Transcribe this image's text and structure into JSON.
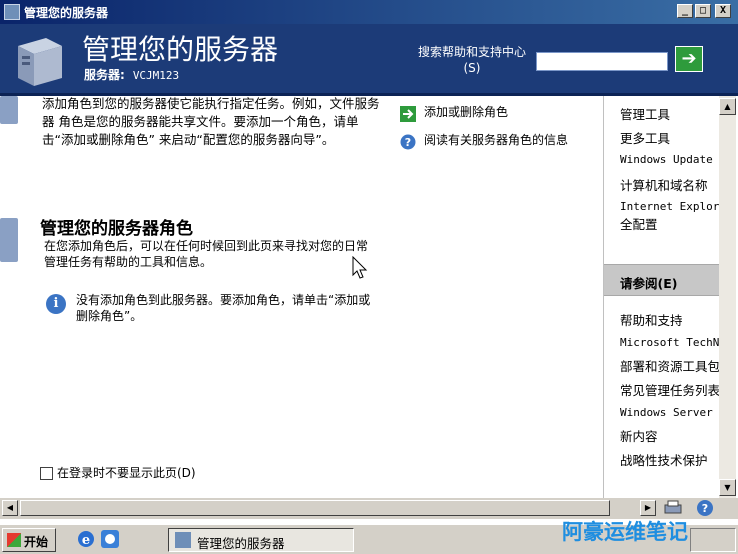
{
  "window": {
    "title": "管理您的服务器",
    "controls": {
      "minimize": "_",
      "maximize": "□",
      "close": "X"
    }
  },
  "header": {
    "title": "管理您的服务器",
    "server_label": "服务器:",
    "server_name": "VCJM123",
    "search_label": "搜索帮助和支持中心(S)",
    "search_value": "",
    "go_icon": "arrow-right-icon"
  },
  "main": {
    "intro_text": "添加角色到您的服务器使它能执行指定任务。例如，文件服务器 角色是您的服务器能共享文件。要添加一个角色，请单击“添加或删除角色” 来启动“配置您的服务器向导”。",
    "roles_title": "管理您的服务器角色",
    "roles_description": "在您添加角色后，可以在任何时候回到此页来寻找对您的日常管理任务有帮助的工具和信息。",
    "info_text": "没有添加角色到此服务器。要添加角色，请单击“添加或删除角色”。",
    "actions": [
      {
        "label": "添加或删除角色",
        "icon": "green-arrow-icon"
      },
      {
        "label": "阅读有关服务器角色的信息",
        "icon": "help-icon"
      }
    ],
    "dont_show_label": "在登录时不要显示此页(D)",
    "dont_show_checked": false
  },
  "right_pane": {
    "tools": [
      "管理工具",
      "更多工具",
      "Windows Update",
      "计算机和域名称",
      "Internet Explorer",
      "全配置"
    ],
    "see_also_header": "请参阅(E)",
    "see_also": [
      "帮助和支持",
      "Microsoft TechNet",
      "部署和资源工具包",
      "常见管理任务列表",
      "Windows Server",
      "新内容",
      "战略性技术保护"
    ]
  },
  "taskbar": {
    "start_label": "开始",
    "task_label": "管理您的服务器",
    "tray_text": ""
  },
  "watermark": "阿豪运维笔记"
}
